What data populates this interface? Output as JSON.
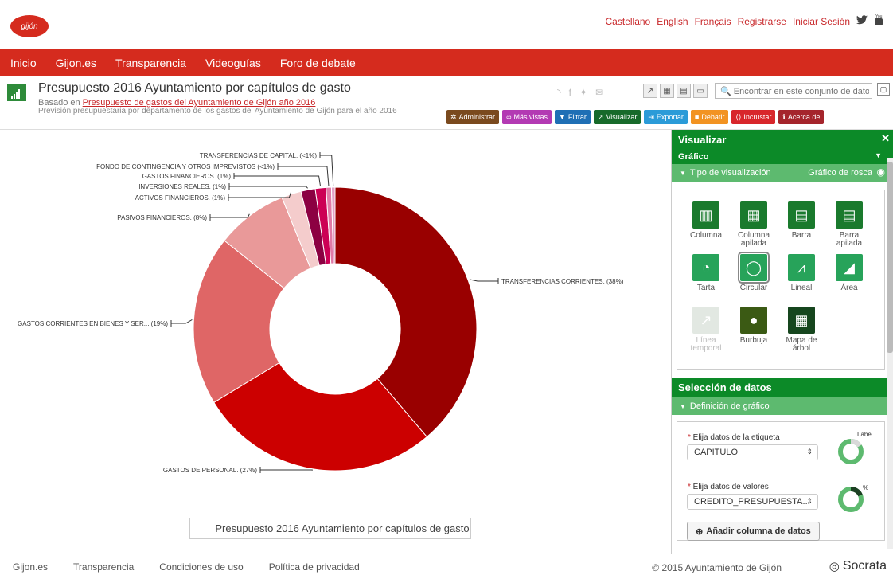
{
  "header": {
    "logo_text": "gijón",
    "links": [
      "Castellano",
      "English",
      "Français",
      "Registrarse",
      "Iniciar Sesión"
    ],
    "twitter_glyph": "🐦",
    "youtube_glyph": "▶"
  },
  "nav": {
    "items": [
      "Inicio",
      "Gijon.es",
      "Transparencia",
      "Videoguías",
      "Foro de debate"
    ]
  },
  "dataset": {
    "title": "Presupuesto 2016 Ayuntamiento por capítulos de gasto",
    "based_prefix": "Basado en",
    "based_link": "Presupuesto de gastos del Ayuntamiento de Gijón año 2016",
    "description": "Previsión presupuestaria por departamento de los gastos del Ayuntamiento de Gijón para el año 2016",
    "search_placeholder": "Encontrar en este conjunto de datos"
  },
  "actions": [
    {
      "label": "Administrar",
      "color": "#7a4a1e",
      "icon": "✲"
    },
    {
      "label": "Más vistas",
      "color": "#b33ab3",
      "icon": "∞"
    },
    {
      "label": "Filtrar",
      "color": "#1f6fb5",
      "icon": "▼"
    },
    {
      "label": "Visualizar",
      "color": "#176a2a",
      "icon": "↗"
    },
    {
      "label": "Exportar",
      "color": "#2b9bd8",
      "icon": "⇥"
    },
    {
      "label": "Debatir",
      "color": "#f29322",
      "icon": "■"
    },
    {
      "label": "Incrustar",
      "color": "#d8262b",
      "icon": "⟨⟩"
    },
    {
      "label": "Acerca de",
      "color": "#a5252c",
      "icon": "ℹ"
    }
  ],
  "chart_data": {
    "type": "pie",
    "donut": true,
    "title": "Presupuesto 2016 Ayuntamiento por capítulos de gasto",
    "slices": [
      {
        "label": "TRANSFERENCIAS CORRIENTES. (38%)",
        "value": 38,
        "color": "#990000"
      },
      {
        "label": "GASTOS DE PERSONAL. (27%)",
        "value": 27,
        "color": "#cc0000"
      },
      {
        "label": "GASTOS CORRIENTES EN BIENES Y SER... (19%)",
        "value": 19,
        "color": "#df6666"
      },
      {
        "label": "PASIVOS FINANCIEROS. (8%)",
        "value": 8,
        "color": "#e99999"
      },
      {
        "label": "ACTIVOS FINANCIEROS. (1%)",
        "value": 2.2,
        "color": "#f4cccc"
      },
      {
        "label": "INVERSIONES REALES. (1%)",
        "value": 1.6,
        "color": "#8c0042"
      },
      {
        "label": "GASTOS FINANCIEROS. (1%)",
        "value": 1.2,
        "color": "#cc0055"
      },
      {
        "label": "FONDO DE CONTINGENCIA Y OTROS IMPREVISTOS (<1%)",
        "value": 0.6,
        "color": "#e07aa6"
      },
      {
        "label": "TRANSFERENCIAS DE CAPITAL. (<1%)",
        "value": 0.4,
        "color": "#e3a0c6"
      }
    ]
  },
  "panel": {
    "title": "Visualizar",
    "section": "Gráfico",
    "viz_type_label": "Tipo de visualización",
    "viz_type_value": "Gráfico de rosca",
    "types": [
      {
        "label1": "Columna",
        "label2": "",
        "icon": "▥",
        "color": "#1a7a2d"
      },
      {
        "label1": "Columna",
        "label2": "apilada",
        "icon": "▦",
        "color": "#1a7a2d"
      },
      {
        "label1": "Barra",
        "label2": "",
        "icon": "▤",
        "color": "#1a7a2d"
      },
      {
        "label1": "Barra",
        "label2": "apilada",
        "icon": "▤",
        "color": "#1a7a2d"
      },
      {
        "label1": "Tarta",
        "label2": "",
        "icon": "◔",
        "color": "#27a35a"
      },
      {
        "label1": "Circular",
        "label2": "",
        "icon": "◯",
        "color": "#27a35a"
      },
      {
        "label1": "Lineal",
        "label2": "",
        "icon": "⩘",
        "color": "#27a35a"
      },
      {
        "label1": "Área",
        "label2": "",
        "icon": "◢",
        "color": "#27a35a"
      },
      {
        "label1": "Línea",
        "label2": "temporal",
        "icon": "↗",
        "color": "#e2e8e2"
      },
      {
        "label1": "Burbuja",
        "label2": "",
        "icon": "●",
        "color": "#3b5a14"
      },
      {
        "label1": "Mapa de",
        "label2": "árbol",
        "icon": "▦",
        "color": "#16461e"
      }
    ],
    "data_section": "Selección de datos",
    "data_sub": "Definición de gráfico",
    "label_field": "Elija datos de la etiqueta",
    "label_value": "CAPITULO",
    "values_field": "Elija datos de valores",
    "values_value": "CREDITO_PRESUPUESTA...",
    "ring_label": "Label",
    "ring_pct": "%",
    "add_column": "Añadir columna de datos"
  },
  "footer": {
    "links": [
      "Gijon.es",
      "Transparencia",
      "Condiciones de uso",
      "Política de privacidad"
    ],
    "copyright": "© 2015 Ayuntamiento de Gijón",
    "brand": "Socrata"
  }
}
